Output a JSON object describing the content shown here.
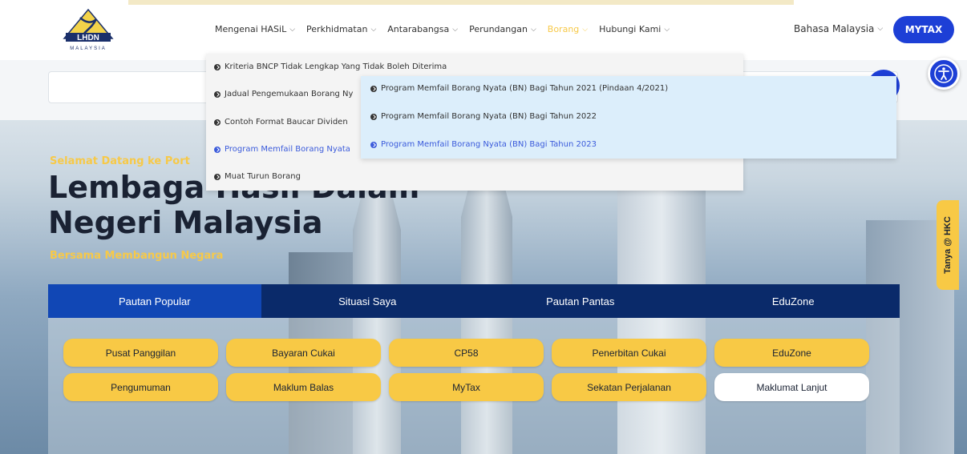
{
  "header": {
    "logo_text": "LHDN",
    "logo_subtext": "MALAYSIA",
    "nav": [
      {
        "label": "Mengenai HASiL"
      },
      {
        "label": "Perkhidmatan"
      },
      {
        "label": "Antarabangsa"
      },
      {
        "label": "Perundangan"
      },
      {
        "label": "Borang"
      },
      {
        "label": "Hubungi Kami"
      }
    ],
    "language": "Bahasa Malaysia",
    "mytax_label": "MYTAX"
  },
  "dropdown": {
    "items": [
      {
        "label": "Kriteria BNCP Tidak Lengkap Yang Tidak Boleh Diterima"
      },
      {
        "label": "Jadual Pengemukaan Borang Ny"
      },
      {
        "label": "Contoh Format Baucar Dividen"
      },
      {
        "label": "Program Memfail Borang Nyata"
      },
      {
        "label": "Muat Turun Borang"
      }
    ]
  },
  "submenu": {
    "items": [
      {
        "label": "Program Memfail Borang Nyata (BN) Bagi Tahun 2021 (Pindaan 4/2021)"
      },
      {
        "label": "Program Memfail Borang Nyata (BN) Bagi Tahun 2022"
      },
      {
        "label": "Program Memfail Borang Nyata (BN) Bagi Tahun 2023"
      }
    ]
  },
  "hero": {
    "welcome": "Selamat Datang ke Port",
    "title": "Lembaga Hasil Dalam Negeri Malaysia",
    "subtitle": "Bersama Membangun Negara"
  },
  "tabs": [
    {
      "label": "Pautan Popular"
    },
    {
      "label": "Situasi Saya"
    },
    {
      "label": "Pautan Pantas"
    },
    {
      "label": "EduZone"
    }
  ],
  "quick_links": [
    {
      "label": "Pusat Panggilan"
    },
    {
      "label": "Bayaran Cukai"
    },
    {
      "label": "CP58"
    },
    {
      "label": "Penerbitan Cukai"
    },
    {
      "label": "EduZone"
    },
    {
      "label": "Pengumuman"
    },
    {
      "label": "Maklum Balas"
    },
    {
      "label": "MyTax"
    },
    {
      "label": "Sekatan Perjalanan"
    },
    {
      "label": "Maklumat Lanjut"
    }
  ],
  "hkc_label": "Tanya @ HKC",
  "colors": {
    "brand_blue": "#1d3fd6",
    "navy": "#0a2a6a",
    "yellow": "#f8c945",
    "active_link": "#3b5bdb"
  }
}
